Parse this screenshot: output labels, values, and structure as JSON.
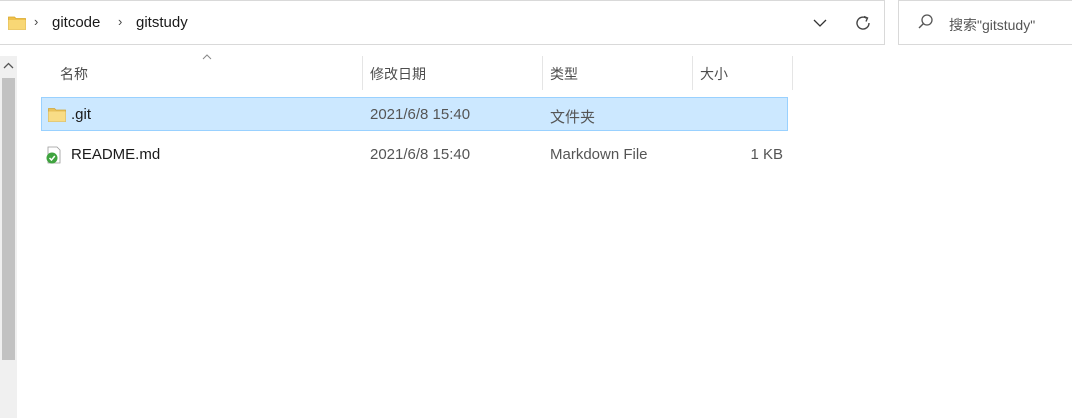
{
  "address_bar": {
    "crumbs": [
      "gitcode",
      "gitstudy"
    ],
    "separator": "›"
  },
  "search": {
    "placeholder": "搜索\"gitstudy\""
  },
  "columns": {
    "name": "名称",
    "modified": "修改日期",
    "type": "类型",
    "size": "大小"
  },
  "files": [
    {
      "name": ".git",
      "modified": "2021/6/8 15:40",
      "type": "文件夹",
      "size": "",
      "icon": "folder-icon",
      "selected": true
    },
    {
      "name": "README.md",
      "modified": "2021/6/8 15:40",
      "type": "Markdown File",
      "size": "1 KB",
      "icon": "markdown-file-icon",
      "selected": false
    }
  ],
  "colors": {
    "selection_bg": "#cce8ff",
    "selection_border": "#99d1ff",
    "folder_yellow": "#f8d775"
  }
}
